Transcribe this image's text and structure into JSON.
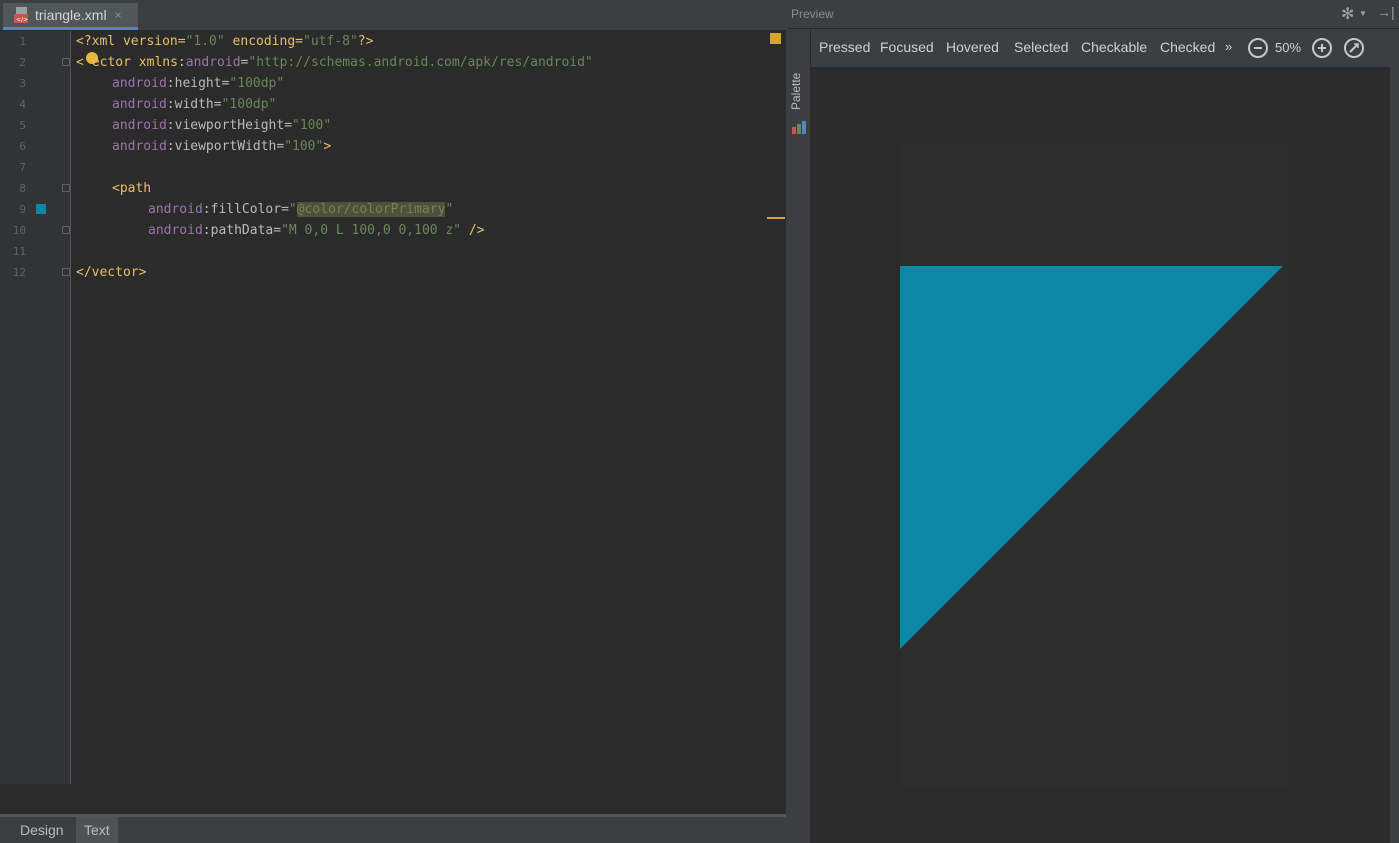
{
  "editor": {
    "tab": {
      "filename": "triangle.xml",
      "close": "×",
      "icon": "xml-file-icon"
    },
    "line_numbers": [
      "1",
      "2",
      "3",
      "4",
      "5",
      "6",
      "7",
      "8",
      "9",
      "10",
      "11",
      "12"
    ],
    "code": {
      "l1": {
        "a": "<?xml version=",
        "b": "\"1.0\"",
        "c": " encoding=",
        "d": "\"utf-8\"",
        "e": "?>"
      },
      "l2": {
        "a": "<",
        "b": "ector xmlns:",
        "c": "android",
        "d": "=",
        "e": "\"http://schemas.android.com/apk/res/android\""
      },
      "l3": {
        "ns": "android",
        "attr": ":height=",
        "val": "\"100dp\""
      },
      "l4": {
        "ns": "android",
        "attr": ":width=",
        "val": "\"100dp\""
      },
      "l5": {
        "ns": "android",
        "attr": ":viewportHeight=",
        "val": "\"100\""
      },
      "l6": {
        "ns": "android",
        "attr": ":viewportWidth=",
        "val": "\"100\"",
        "end": ">"
      },
      "l8": {
        "tag": "<path"
      },
      "l9": {
        "ns": "android",
        "attr": ":fillColor=",
        "q1": "\"",
        "hl": "@color/colorPrimary",
        "q2": "\""
      },
      "l10": {
        "ns": "android",
        "attr": ":pathData=",
        "val": "\"M 0,0 L 100,0 0,100 z\"",
        "end": " />"
      },
      "l12": {
        "tag": "</vector>"
      }
    },
    "fill_color_swatch": "#0c87a5",
    "bottom_tabs": {
      "design": "Design",
      "text": "Text"
    }
  },
  "preview": {
    "title": "Preview",
    "palette_label": "Palette",
    "states": [
      "Pressed",
      "Focused",
      "Hovered",
      "Selected",
      "Checkable",
      "Checked"
    ],
    "more": "»",
    "zoom": "50%",
    "shape_color": "#0c87a5"
  }
}
